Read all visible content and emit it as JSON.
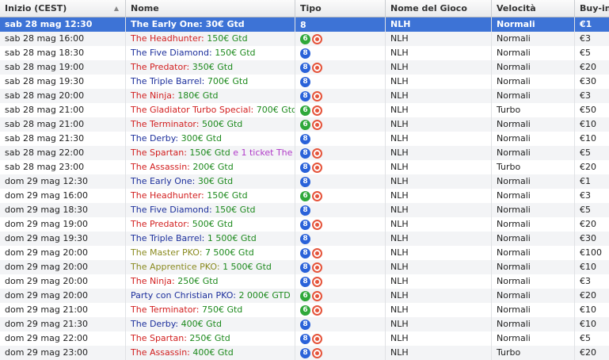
{
  "columns": [
    "Inizio (CEST)",
    "Nome",
    "Tipo",
    "Nome del Gioco",
    "Velocità",
    "Buy-in"
  ],
  "colors": {
    "red": "#d21f1f",
    "navy": "#1c2f9c",
    "olive": "#8a8a1f",
    "green": "#1e8a1e",
    "purple": "#b03ac8",
    "selected": "#3d73d6"
  },
  "rows": [
    {
      "start": "sab 28 mag 12:30",
      "name": "The Early One:",
      "prize": "30€ Gtd",
      "extra": "",
      "nameColor": "navy",
      "badge": "8",
      "ko": false,
      "game": "NLH",
      "speed": "Normali",
      "buyin": "€1",
      "selected": true
    },
    {
      "start": "sab 28 mag 16:00",
      "name": "The Headhunter:",
      "prize": "150€ Gtd",
      "extra": "",
      "nameColor": "red",
      "badge": "6",
      "ko": true,
      "game": "NLH",
      "speed": "Normali",
      "buyin": "€3"
    },
    {
      "start": "sab 28 mag 18:30",
      "name": "The Five Diamond:",
      "prize": "150€ Gtd",
      "extra": "",
      "nameColor": "navy",
      "badge": "8",
      "ko": false,
      "game": "NLH",
      "speed": "Normali",
      "buyin": "€5"
    },
    {
      "start": "sab 28 mag 19:00",
      "name": "The Predator:",
      "prize": "350€ Gtd",
      "extra": "",
      "nameColor": "red",
      "badge": "8",
      "ko": true,
      "game": "NLH",
      "speed": "Normali",
      "buyin": "€20"
    },
    {
      "start": "sab 28 mag 19:30",
      "name": "The Triple Barrel:",
      "prize": "700€ Gtd",
      "extra": "",
      "nameColor": "navy",
      "badge": "8",
      "ko": false,
      "game": "NLH",
      "speed": "Normali",
      "buyin": "€30"
    },
    {
      "start": "sab 28 mag 20:00",
      "name": "The Ninja:",
      "prize": "180€ Gtd",
      "extra": "",
      "nameColor": "red",
      "badge": "8",
      "ko": true,
      "game": "NLH",
      "speed": "Normali",
      "buyin": "€3"
    },
    {
      "start": "sab 28 mag 21:00",
      "name": "The Gladiator Turbo Special:",
      "prize": "700€ Gtd",
      "extra": "",
      "nameColor": "red",
      "badge": "6",
      "ko": true,
      "game": "NLH",
      "speed": "Turbo",
      "buyin": "€50"
    },
    {
      "start": "sab 28 mag 21:00",
      "name": "The Terminator:",
      "prize": "500€ Gtd",
      "extra": "",
      "nameColor": "red",
      "badge": "6",
      "ko": true,
      "game": "NLH",
      "speed": "Normali",
      "buyin": "€10"
    },
    {
      "start": "sab 28 mag 21:30",
      "name": "The Derby:",
      "prize": "300€ Gtd",
      "extra": "",
      "nameColor": "navy",
      "badge": "8",
      "ko": false,
      "game": "NLH",
      "speed": "Normali",
      "buyin": "€10"
    },
    {
      "start": "sab 28 mag 22:00",
      "name": "The Spartan:",
      "prize": "150€ Gtd",
      "extra": "e 1 ticket The Mast...",
      "nameColor": "red",
      "badge": "8",
      "ko": true,
      "game": "NLH",
      "speed": "Normali",
      "buyin": "€5"
    },
    {
      "start": "sab 28 mag 23:00",
      "name": "The Assassin:",
      "prize": "200€ Gtd",
      "extra": "",
      "nameColor": "red",
      "badge": "8",
      "ko": true,
      "game": "NLH",
      "speed": "Turbo",
      "buyin": "€20"
    },
    {
      "start": "dom 29 mag 12:30",
      "name": "The Early One:",
      "prize": "30€ Gtd",
      "extra": "",
      "nameColor": "navy",
      "badge": "8",
      "ko": false,
      "game": "NLH",
      "speed": "Normali",
      "buyin": "€1"
    },
    {
      "start": "dom 29 mag 16:00",
      "name": "The Headhunter:",
      "prize": "150€ Gtd",
      "extra": "",
      "nameColor": "red",
      "badge": "6",
      "ko": true,
      "game": "NLH",
      "speed": "Normali",
      "buyin": "€3"
    },
    {
      "start": "dom 29 mag 18:30",
      "name": "The Five Diamond:",
      "prize": "150€ Gtd",
      "extra": "",
      "nameColor": "navy",
      "badge": "8",
      "ko": false,
      "game": "NLH",
      "speed": "Normali",
      "buyin": "€5"
    },
    {
      "start": "dom 29 mag 19:00",
      "name": "The Predator:",
      "prize": "500€ Gtd",
      "extra": "",
      "nameColor": "red",
      "badge": "8",
      "ko": true,
      "game": "NLH",
      "speed": "Normali",
      "buyin": "€20"
    },
    {
      "start": "dom 29 mag 19:30",
      "name": "The Triple Barrel:",
      "prize": "1 500€ Gtd",
      "extra": "",
      "nameColor": "navy",
      "badge": "8",
      "ko": false,
      "game": "NLH",
      "speed": "Normali",
      "buyin": "€30"
    },
    {
      "start": "dom 29 mag 20:00",
      "name": "The Master PKO:",
      "prize": "7 500€ Gtd",
      "extra": "",
      "nameColor": "olive",
      "badge": "8",
      "ko": true,
      "game": "NLH",
      "speed": "Normali",
      "buyin": "€100"
    },
    {
      "start": "dom 29 mag 20:00",
      "name": "The Apprentice PKO:",
      "prize": "1 500€ Gtd",
      "extra": "",
      "nameColor": "olive",
      "badge": "8",
      "ko": true,
      "game": "NLH",
      "speed": "Normali",
      "buyin": "€10"
    },
    {
      "start": "dom 29 mag 20:00",
      "name": "The Ninja:",
      "prize": "250€ Gtd",
      "extra": "",
      "nameColor": "red",
      "badge": "8",
      "ko": true,
      "game": "NLH",
      "speed": "Normali",
      "buyin": "€3"
    },
    {
      "start": "dom 29 mag 20:00",
      "name": "Party con Christian PKO:",
      "prize": "2 000€ GTD",
      "extra": "",
      "nameColor": "navy",
      "badge": "6",
      "ko": true,
      "game": "NLH",
      "speed": "Normali",
      "buyin": "€20"
    },
    {
      "start": "dom 29 mag 21:00",
      "name": "The Terminator:",
      "prize": "750€ Gtd",
      "extra": "",
      "nameColor": "red",
      "badge": "6",
      "ko": true,
      "game": "NLH",
      "speed": "Normali",
      "buyin": "€10"
    },
    {
      "start": "dom 29 mag 21:30",
      "name": "The Derby:",
      "prize": "400€ Gtd",
      "extra": "",
      "nameColor": "navy",
      "badge": "8",
      "ko": false,
      "game": "NLH",
      "speed": "Normali",
      "buyin": "€10"
    },
    {
      "start": "dom 29 mag 22:00",
      "name": "The Spartan:",
      "prize": "250€ Gtd",
      "extra": "",
      "nameColor": "red",
      "badge": "8",
      "ko": true,
      "game": "NLH",
      "speed": "Normali",
      "buyin": "€5"
    },
    {
      "start": "dom 29 mag 23:00",
      "name": "The Assassin:",
      "prize": "400€ Gtd",
      "extra": "",
      "nameColor": "red",
      "badge": "8",
      "ko": true,
      "game": "NLH",
      "speed": "Turbo",
      "buyin": "€20"
    }
  ]
}
